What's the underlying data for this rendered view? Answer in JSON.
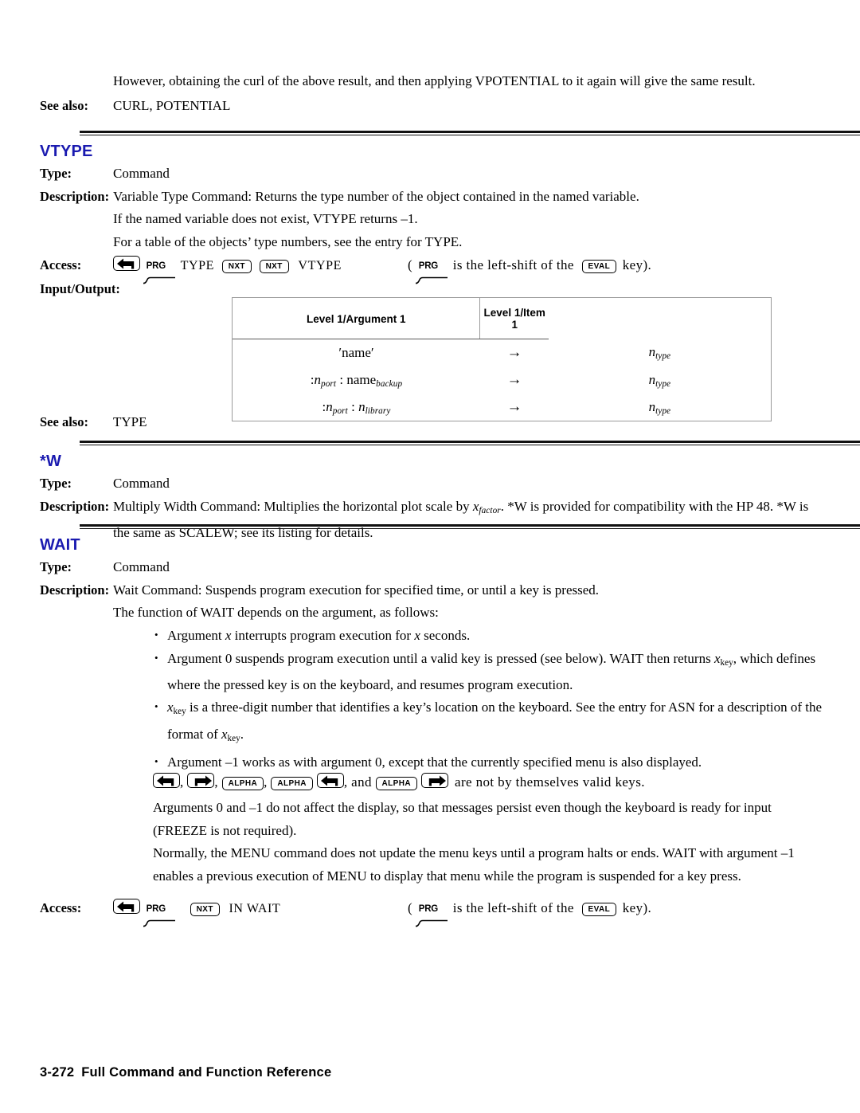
{
  "document": {
    "footer": {
      "page_number": "3-272",
      "title": "Full Command and Function Reference"
    }
  },
  "vpotential_tail": {
    "paragraph": "However, obtaining the curl of the above result, and then applying VPOTENTIAL to it again will give the same result.",
    "see_also_label": "See also:",
    "see_also_value": "CURL, POTENTIAL"
  },
  "vtype": {
    "heading": "VTYPE",
    "type_label": "Type:",
    "type_value": "Command",
    "description_label": "Description:",
    "description_p1": "Variable Type Command: Returns the type number of the object contained in the named variable.",
    "description_p2": "If the named variable does not exist, VTYPE returns –1.",
    "description_p3": "For a table of the objects’ type numbers, see the entry for TYPE.",
    "access_label": "Access:",
    "access_keys": {
      "left_shift_key": "left-shift-arrow",
      "menu_label": "PRG",
      "seq_1": "TYPE",
      "nxt_key_1": "NXT",
      "nxt_key_2": "NXT",
      "seq_2": "VTYPE"
    },
    "access_note": {
      "open_paren": "(",
      "menu_label": "PRG",
      "text_mid": "is the left-shift of the",
      "eval_key": "EVAL",
      "text_end": "key)."
    },
    "io_label": "Input/Output:",
    "io_table": {
      "headers": [
        "Level 1/Argument 1",
        "Level 1/Item 1"
      ],
      "arrow": "→",
      "rows": [
        {
          "arg_prefix": "",
          "arg_main": "′name′",
          "arg_sub": "",
          "arg_mid": "",
          "arg_main2": "",
          "arg_sub2": "",
          "result_main": "n",
          "result_sub": "type"
        },
        {
          "arg_prefix": ":",
          "arg_main": "n",
          "arg_sub": "port",
          "arg_mid": " : ",
          "arg_main2": "name",
          "arg_sub2": "backup",
          "result_main": "n",
          "result_sub": "type"
        },
        {
          "arg_prefix": ":",
          "arg_main": "n",
          "arg_sub": "port",
          "arg_mid": " : ",
          "arg_main2": "n",
          "arg_sub2": "library",
          "result_main": "n",
          "result_sub": "type"
        }
      ]
    },
    "see_also_label": "See also:",
    "see_also_value": "TYPE"
  },
  "star_w": {
    "heading": "*W",
    "type_label": "Type:",
    "type_value": "Command",
    "description_label": "Description:",
    "description_part1": "Multiply Width Command: Multiplies the horizontal plot scale by ",
    "description_var": "x",
    "description_var_sub": "factor",
    "description_part2": ". *W is provided for compatibility with the HP 48. *W is the same as SCALEW; see its listing for details."
  },
  "wait": {
    "heading": "WAIT",
    "type_label": "Type:",
    "type_value": "Command",
    "description_label": "Description:",
    "description_p1": "Wait Command: Suspends program execution for specified time, or until a key is pressed.",
    "description_p2": "The function of WAIT depends on the argument, as follows:",
    "bullet_1_part1": "Argument ",
    "bullet_1_var": "x",
    "bullet_1_part2": " interrupts program execution for ",
    "bullet_1_var2": "x",
    "bullet_1_part3": " seconds.",
    "bullet_2_part1": "Argument 0 suspends program execution until a valid key is pressed (see below). WAIT then returns ",
    "bullet_2_var": "x",
    "bullet_2_var_sub": "key",
    "bullet_2_part2": ", which defines where the pressed key is on the keyboard, and resumes program execution.",
    "bullet_2_cont_var": "x",
    "bullet_2_cont_var_sub": "key",
    "bullet_2_cont_part1": " is a three-digit number that identifies a key’s location on the keyboard. See the entry for ASN for a description of the format of ",
    "bullet_2_cont_var2": "x",
    "bullet_2_cont_var2_sub": "key",
    "bullet_2_cont_part2": ".",
    "bullet_3_text": "Argument –1 works as with argument 0, except that the currently specified menu is also displayed.",
    "invalid_keys": {
      "key_1": "left-shift-arrow",
      "sep_1": ", ",
      "key_2": "right-shift-arrow",
      "sep_2": ", ",
      "key_3": "ALPHA",
      "sep_3": ", ",
      "key_4": "ALPHA",
      "key_5": "left-shift-arrow",
      "sep_4": ", and ",
      "key_6": "ALPHA",
      "key_7": "right-shift-arrow",
      "trailing_text": "are not by themselves valid keys."
    },
    "para_freeze": "Arguments 0 and –1 do not affect the display, so that messages persist even though the keyboard is ready for input (FREEZE is not required).",
    "para_menu": "Normally, the MENU command does not update the menu keys until a program halts or ends. WAIT with argument –1 enables a previous execution of MENU to display that menu while the program is suspended for a key press.",
    "access_label": "Access:",
    "access_keys": {
      "left_shift_key": "left-shift-arrow",
      "menu_label": "PRG",
      "nxt_key": "NXT",
      "seq_1": "IN WAIT"
    },
    "access_note": {
      "open_paren": "(",
      "menu_label": "PRG",
      "text_mid": "is the left-shift of the",
      "eval_key": "EVAL",
      "text_end": "key)."
    }
  },
  "colors": {
    "heading_blue": "#1a1ab0",
    "rule_black": "#111111",
    "table_border": "#9a9a9a"
  }
}
